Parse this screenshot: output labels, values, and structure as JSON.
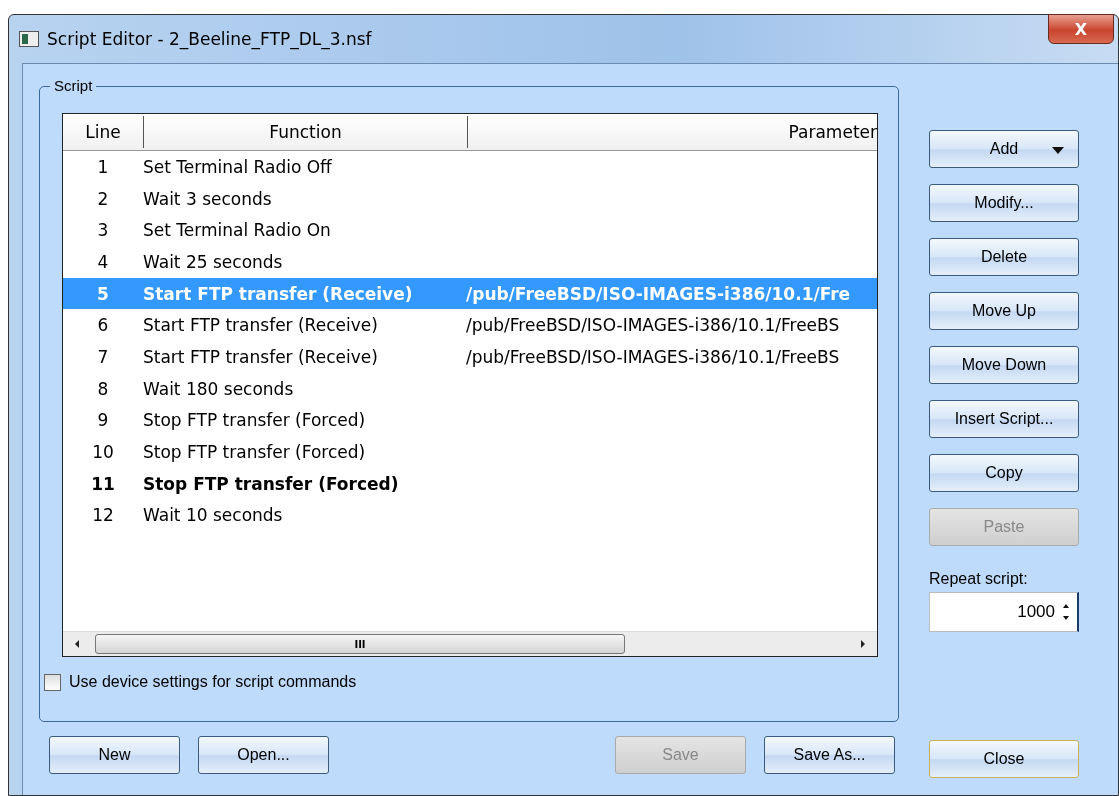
{
  "window": {
    "title": "Script Editor - 2_Beeline_FTP_DL_3.nsf",
    "close_glyph": "X"
  },
  "script_group": {
    "label": "Script"
  },
  "table": {
    "columns": [
      "Line",
      "Function",
      "Parameter"
    ],
    "rows": [
      {
        "line": "1",
        "function": "Set Terminal Radio Off",
        "parameter": "",
        "selected": false,
        "bold": false
      },
      {
        "line": "2",
        "function": "Wait 3 seconds",
        "parameter": "",
        "selected": false,
        "bold": false
      },
      {
        "line": "3",
        "function": "Set Terminal Radio On",
        "parameter": "",
        "selected": false,
        "bold": false
      },
      {
        "line": "4",
        "function": "Wait 25 seconds",
        "parameter": "",
        "selected": false,
        "bold": false
      },
      {
        "line": "5",
        "function": "Start FTP transfer (Receive)",
        "parameter": "/pub/FreeBSD/ISO-IMAGES-i386/10.1/Fre",
        "selected": true,
        "bold": true
      },
      {
        "line": "6",
        "function": "Start FTP transfer (Receive)",
        "parameter": "/pub/FreeBSD/ISO-IMAGES-i386/10.1/FreeBS",
        "selected": false,
        "bold": false
      },
      {
        "line": "7",
        "function": "Start FTP transfer (Receive)",
        "parameter": "/pub/FreeBSD/ISO-IMAGES-i386/10.1/FreeBS",
        "selected": false,
        "bold": false
      },
      {
        "line": "8",
        "function": "Wait 180 seconds",
        "parameter": "",
        "selected": false,
        "bold": false
      },
      {
        "line": "9",
        "function": "Stop FTP transfer (Forced)",
        "parameter": "",
        "selected": false,
        "bold": false
      },
      {
        "line": "10",
        "function": "Stop FTP transfer (Forced)",
        "parameter": "",
        "selected": false,
        "bold": false
      },
      {
        "line": "11",
        "function": "Stop FTP transfer (Forced)",
        "parameter": "",
        "selected": false,
        "bold": true
      },
      {
        "line": "12",
        "function": "Wait 10 seconds",
        "parameter": "",
        "selected": false,
        "bold": false
      }
    ],
    "scroll_thumb_glyph": "III"
  },
  "use_device_settings": {
    "label": "Use device settings for script commands",
    "checked": false
  },
  "side_buttons": [
    {
      "label": "Add",
      "disabled": false,
      "dropdown": true
    },
    {
      "label": "Modify...",
      "disabled": false,
      "dropdown": false
    },
    {
      "label": "Delete",
      "disabled": false,
      "dropdown": false
    },
    {
      "label": "Move Up",
      "disabled": false,
      "dropdown": false
    },
    {
      "label": "Move Down",
      "disabled": false,
      "dropdown": false
    },
    {
      "label": "Insert Script...",
      "disabled": false,
      "dropdown": false
    },
    {
      "label": "Copy",
      "disabled": false,
      "dropdown": false
    },
    {
      "label": "Paste",
      "disabled": true,
      "dropdown": false
    }
  ],
  "repeat": {
    "label": "Repeat script:",
    "value": "1000"
  },
  "bottom_buttons": [
    {
      "label": "New",
      "disabled": false
    },
    {
      "label": "Open...",
      "disabled": false
    },
    {
      "label": "Save",
      "disabled": true
    },
    {
      "label": "Save As...",
      "disabled": false
    }
  ],
  "close_button": {
    "label": "Close"
  }
}
